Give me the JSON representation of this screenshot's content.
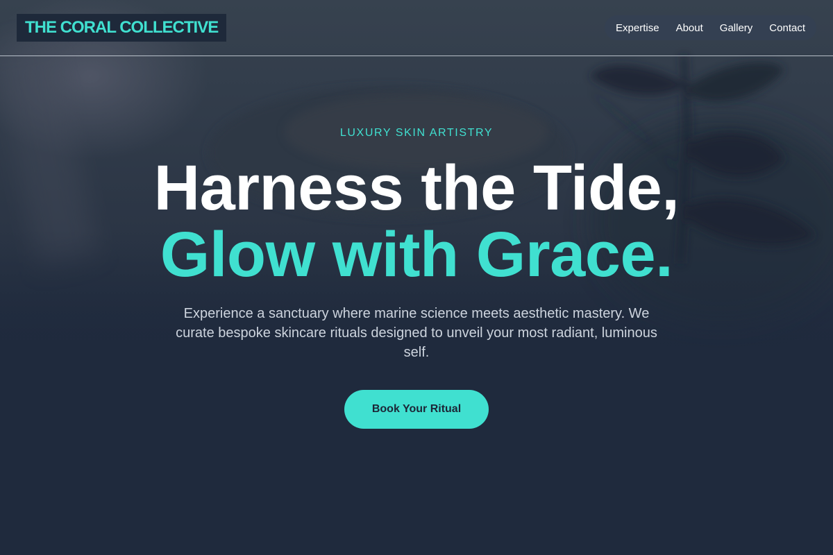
{
  "brand": {
    "name": "THE CORAL COLLECTIVE"
  },
  "nav": {
    "items": [
      "Expertise",
      "About",
      "Gallery",
      "Contact"
    ]
  },
  "hero": {
    "eyebrow": "LUXURY SKIN ARTISTRY",
    "headline_line1": "Harness the Tide,",
    "headline_line2": "Glow with Grace.",
    "subtext": "Experience a sanctuary where marine science meets aesthetic mastery. We curate bespoke skincare rituals designed to unveil your most radiant, luminous self.",
    "cta_label": "Book Your Ritual"
  },
  "theme": {
    "accent": "#40e0d0",
    "background": "#1f2a3d",
    "nav_pill": "#344052",
    "text_primary": "#ffffff",
    "text_muted": "#cdd4de"
  }
}
